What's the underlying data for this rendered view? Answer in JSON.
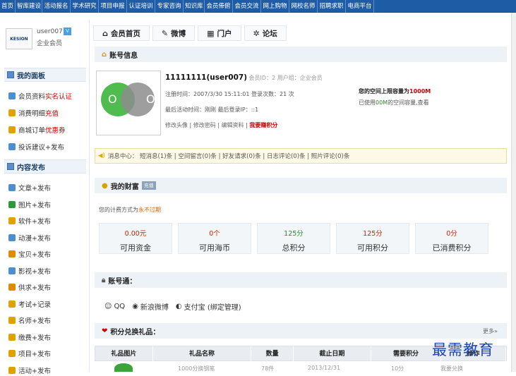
{
  "top_nav": [
    "首页",
    "智库建设",
    "活动报名",
    "学术研究",
    "项目申报",
    "认证培训",
    "专家咨询",
    "知识库",
    "会员俸俯",
    "会员交流",
    "网上购物",
    "网校名师",
    "招聘求职",
    "电商平台"
  ],
  "profile": {
    "logo_text": "KESION",
    "username": "user007",
    "role": "企业会员",
    "badge": "V"
  },
  "sidebar": {
    "section1": "我的面板",
    "items1": [
      {
        "label": "会员资料",
        "extra": "实名认证"
      },
      {
        "label": "消费明细",
        "extra": "充值"
      },
      {
        "label": "商城订单",
        "extra": "优惠券"
      },
      {
        "label": "投诉建议+发布",
        "extra": ""
      }
    ],
    "section2": "内容发布",
    "items2": [
      "文章+发布",
      "图片+发布",
      "软件+发布",
      "动漫+发布",
      "宝贝+发布",
      "影视+发布",
      "供求+发布",
      "考试+记录",
      "名师+发布",
      "缴费+发布",
      "项目+发布",
      "活动+发布"
    ]
  },
  "tabs": [
    {
      "icon": "home-icon",
      "glyph": "⌂",
      "label": "会员首页"
    },
    {
      "icon": "pen-icon",
      "glyph": "✎",
      "label": "微博"
    },
    {
      "icon": "grid-icon",
      "glyph": "▦",
      "label": "门户"
    },
    {
      "icon": "gear-icon",
      "glyph": "✲",
      "label": "论坛"
    }
  ],
  "account": {
    "header": "账号信息",
    "name": "11111111(user007)",
    "member_id_label": "会员ID：2",
    "user_group_label": "用户组：企业会员",
    "reg_line": "注册时间：2007/3/30 15:11:01  登录次数：21 次",
    "last_line": "最后活动时间：刚刚  最后登录IP：::1",
    "links": [
      "修改头像",
      "修改密码",
      "编辑资料",
      "我要赚积分"
    ],
    "space_prefix": "您的空间上限容量为",
    "space_value": "1000M",
    "space_used_prefix": "已使用",
    "space_used_value": "00M",
    "space_used_suffix": "的空间容量,查看"
  },
  "messages": "消息中心： 短消息(1)条 | 空间留言(0)条 | 好友请求(0)条 | 日志评论(0)条 | 照片评论(0)条",
  "wealth": {
    "header": "我的财富",
    "tag": "充值",
    "note_prefix": "您的计费方式为",
    "note_value": "永不过期",
    "stats": [
      {
        "value": "0.00元",
        "label": "可用资金",
        "color": "#cc2200"
      },
      {
        "value": "0个",
        "label": "可用海币",
        "color": "#cc2200"
      },
      {
        "value": "125分",
        "label": "总积分",
        "color": "#2a8a2a"
      },
      {
        "value": "125分",
        "label": "可用积分",
        "color": "#cc2200"
      },
      {
        "value": "0分",
        "label": "已消费积分",
        "color": "#cc2200"
      }
    ]
  },
  "account_bind": {
    "header": "账号通：",
    "items": [
      "QQ",
      "新浪微博",
      "支付宝 (绑定管理)"
    ]
  },
  "gifts": {
    "header": "积分兑换礼品：",
    "more": "更多»",
    "columns": [
      "礼品图片",
      "礼品名称",
      "数量",
      "截止日期",
      "需要积分",
      "操作"
    ],
    "row": [
      "",
      "1000分换钢笔",
      "78件",
      "2013/12/31",
      "10分",
      "我要兑换"
    ]
  },
  "watermark": "最需教育"
}
